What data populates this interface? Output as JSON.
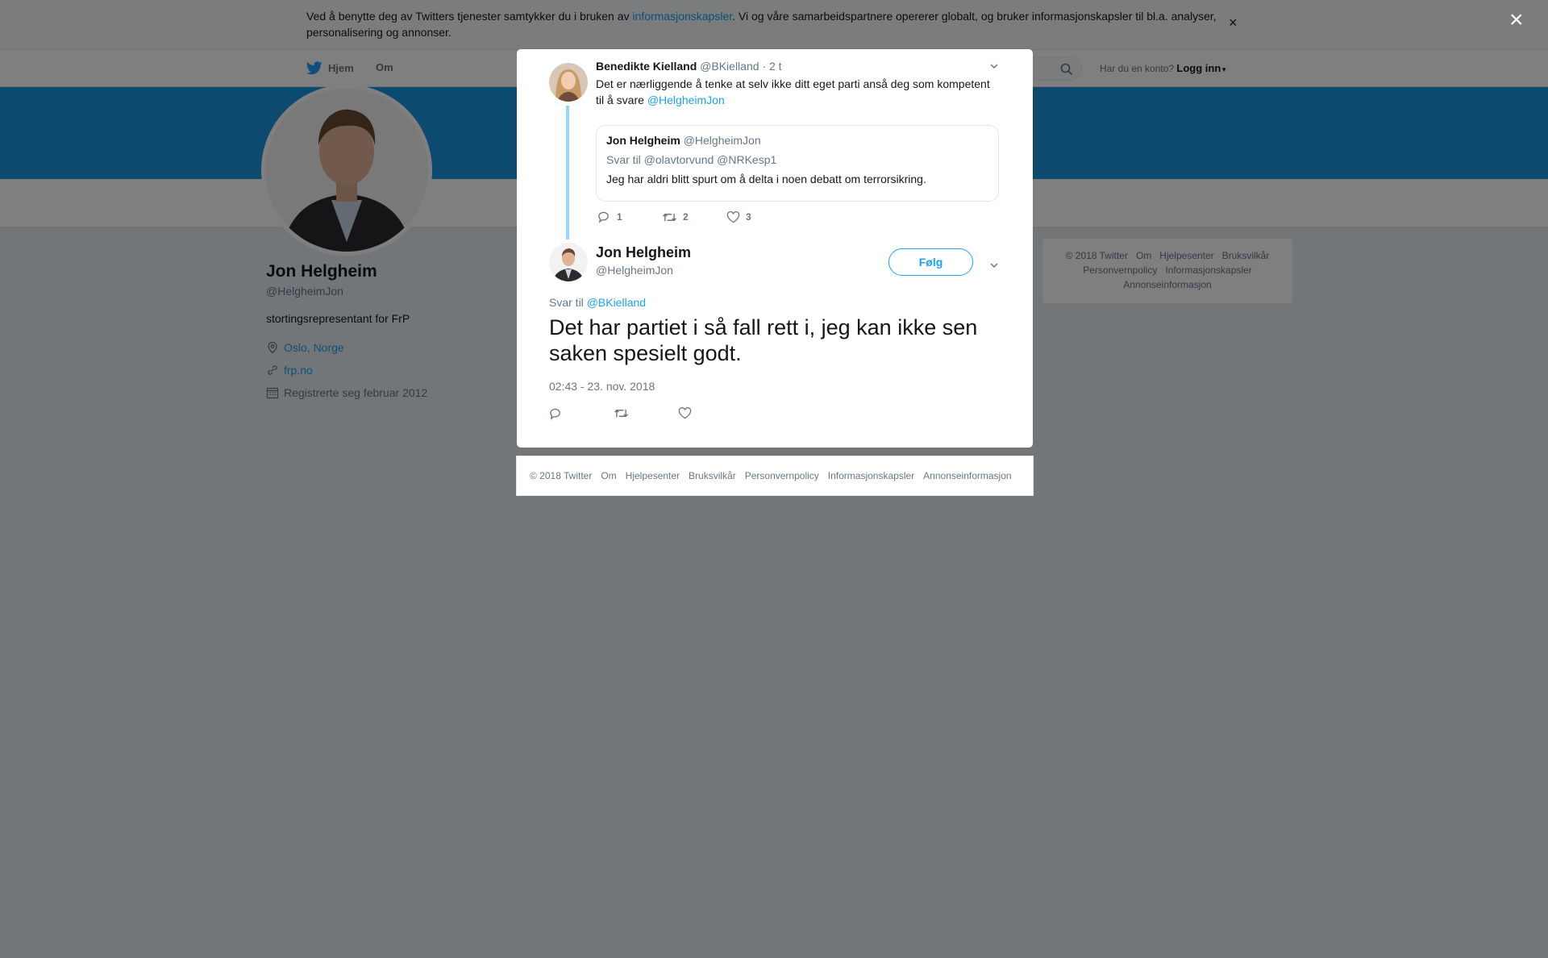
{
  "cookie_banner": {
    "text_before": "Ved å benytte deg av Twitters tjenester samtykker du i bruken av ",
    "link": "informasjonskapsler",
    "text_after": ". Vi og våre samarbeidspartnere opererer globalt, og bruker informasjonskapsler til bl.a. analyser, personalisering og annonser.",
    "close": "×"
  },
  "topnav": {
    "home": "Hjem",
    "about": "Om",
    "login_prompt": "Har du en konto?",
    "login": "Logg inn"
  },
  "profile": {
    "name": "Jon Helgheim",
    "handle": "@HelgheimJon",
    "bio": "stortingsrepresentant for FrP",
    "location": "Oslo, Norge",
    "website": "frp.no",
    "joined": "Registrerte seg februar 2012"
  },
  "side_footer": [
    "© 2018 Twitter",
    "Om",
    "Hjelpesenter",
    "Bruksvilkår",
    "Personvernpolicy",
    "Informasjonskapsler",
    "Annonseinformasjon"
  ],
  "overlay_close": "×",
  "parent_tweet": {
    "name": "Benedikte Kielland",
    "handle": "@BKielland",
    "time": "· 2 t",
    "text": "Det er nærliggende å tenke at selv ikke ditt eget parti anså deg som kompetent til å svare ",
    "mention": "@HelgheimJon",
    "quote": {
      "name": "Jon Helgheim",
      "handle": "@HelgheimJon",
      "reply_to": "Svar til @olavtorvund @NRKesp1",
      "text": "Jeg har aldri blitt spurt om å delta i noen debatt om terrorsikring."
    },
    "replies": "1",
    "retweets": "2",
    "likes": "3"
  },
  "main_tweet": {
    "name": "Jon Helgheim",
    "handle": "@HelgheimJon",
    "follow": "Følg",
    "reply_to_label": "Svar til",
    "reply_to_user": "@BKielland",
    "text": "Det har partiet i så fall rett i, jeg kan ikke sen saken spesielt godt.",
    "timestamp": "02:43 - 23. nov. 2018"
  },
  "modal_footer": [
    "© 2018 Twitter",
    "Om",
    "Hjelpesenter",
    "Bruksvilkår",
    "Personvernpolicy",
    "Informasjonskapsler",
    "Annonseinformasjon"
  ],
  "colors": {
    "accent": "#1da1f2",
    "banner": "#1b95e0",
    "thread_line": "#9ad6f5",
    "muted": "#657786"
  }
}
